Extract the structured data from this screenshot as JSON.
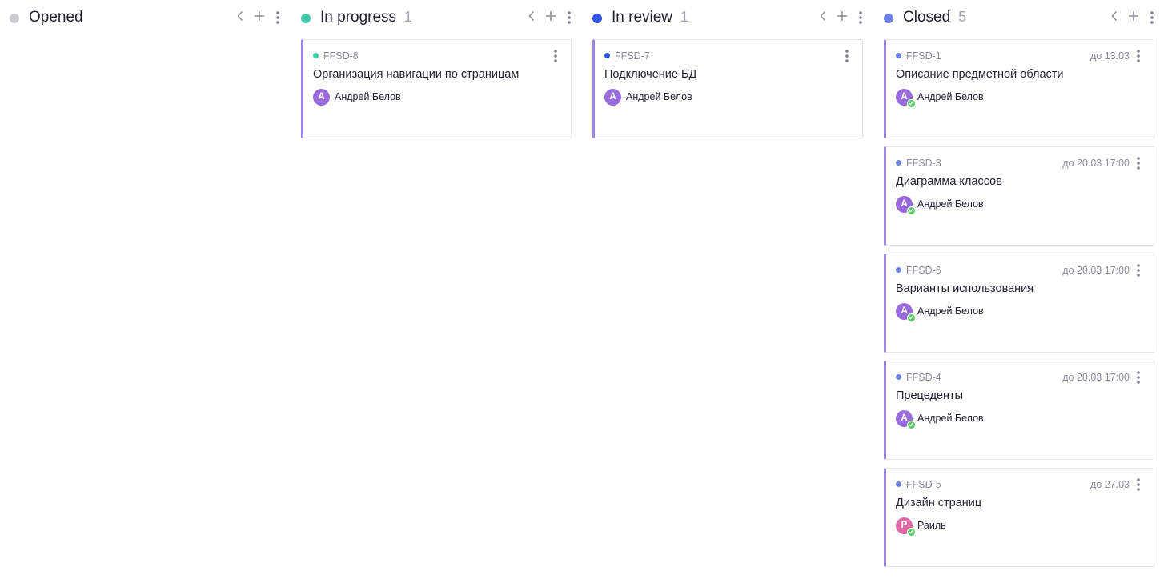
{
  "columns": [
    {
      "title": "Opened",
      "count": "",
      "dot_color": "#c9cbd1",
      "id_dot_color": "#c9cbd1",
      "controls": [
        "chevron-left-icon",
        "plus-icon",
        "more-vertical-icon"
      ],
      "cards": []
    },
    {
      "title": "In progress",
      "count": "1",
      "dot_color": "#3ec9a7",
      "id_dot_color": "#3ec9a7",
      "cards": [
        {
          "id": "FFSD-8",
          "title": "Организация навигации по страницам",
          "due": "",
          "assignee": {
            "initial": "А",
            "name": "Андрей Белов",
            "color": "#9a6bdc",
            "completed": false
          }
        }
      ]
    },
    {
      "title": "In review",
      "count": "1",
      "dot_color": "#2f55e4",
      "id_dot_color": "#2f55e4",
      "cards": [
        {
          "id": "FFSD-7",
          "title": "Подключение БД",
          "due": "",
          "assignee": {
            "initial": "А",
            "name": "Андрей Белов",
            "color": "#9a6bdc",
            "completed": false
          }
        }
      ]
    },
    {
      "title": "Closed",
      "count": "5",
      "dot_color": "#6c82e8",
      "id_dot_color": "#6c82e8",
      "cards": [
        {
          "id": "FFSD-1",
          "title": "Описание предметной области",
          "due": "до 13.03",
          "assignee": {
            "initial": "А",
            "name": "Андрей Белов",
            "color": "#9a6bdc",
            "completed": true
          }
        },
        {
          "id": "FFSD-3",
          "title": "Диаграмма классов",
          "due": "до 20.03 17:00",
          "assignee": {
            "initial": "А",
            "name": "Андрей Белов",
            "color": "#9a6bdc",
            "completed": true
          }
        },
        {
          "id": "FFSD-6",
          "title": "Варианты использования",
          "due": "до 20.03 17:00",
          "assignee": {
            "initial": "А",
            "name": "Андрей Белов",
            "color": "#9a6bdc",
            "completed": true
          }
        },
        {
          "id": "FFSD-4",
          "title": "Прецеденты",
          "due": "до 20.03 17:00",
          "assignee": {
            "initial": "А",
            "name": "Андрей Белов",
            "color": "#9a6bdc",
            "completed": true
          }
        },
        {
          "id": "FFSD-5",
          "title": "Дизайн страниц",
          "due": "до 27.03",
          "assignee": {
            "initial": "Р",
            "name": "Раиль",
            "color": "#e06aa6",
            "completed": true
          }
        }
      ]
    }
  ],
  "colors": {
    "card_accent": "#9a86e8",
    "completed_badge": "#5fcb6a"
  }
}
